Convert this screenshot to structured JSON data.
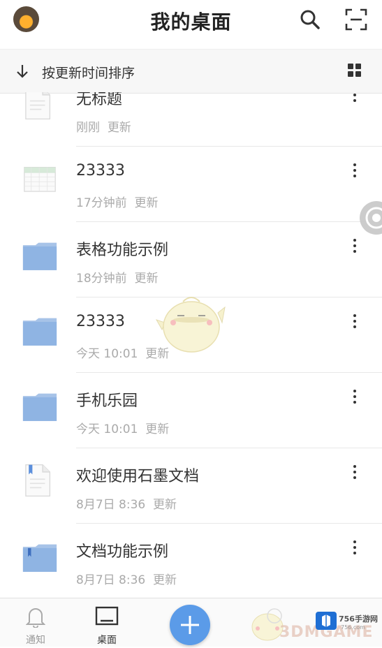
{
  "header": {
    "title": "我的桌面",
    "icons": [
      "avatar",
      "search-icon",
      "scan-icon"
    ]
  },
  "sortbar": {
    "label": "按更新时间排序",
    "icons": [
      "arrow-down-icon",
      "grid-view-icon"
    ]
  },
  "files": [
    {
      "name": "无标题",
      "time": "刚刚",
      "suffix": "更新",
      "type": "document"
    },
    {
      "name": "23333",
      "time": "17分钟前",
      "suffix": "更新",
      "type": "spreadsheet"
    },
    {
      "name": "表格功能示例",
      "time": "18分钟前",
      "suffix": "更新",
      "type": "folder"
    },
    {
      "name": "23333",
      "time": "今天 10:01",
      "suffix": "更新",
      "type": "folder"
    },
    {
      "name": "手机乐园",
      "time": "今天 10:01",
      "suffix": "更新",
      "type": "folder"
    },
    {
      "name": "欢迎使用石墨文档",
      "time": "8月7日 8:36",
      "suffix": "更新",
      "type": "document-bookmarked"
    },
    {
      "name": "文档功能示例",
      "time": "8月7日 8:36",
      "suffix": "更新",
      "type": "folder-bookmarked"
    }
  ],
  "bottom_nav": {
    "tabs": [
      {
        "label": "通知",
        "icon": "bell-icon",
        "active": false
      },
      {
        "label": "桌面",
        "icon": "desktop-icon",
        "active": true
      }
    ],
    "fab_icon": "plus-icon"
  },
  "watermark": {
    "text": "3DMGAME",
    "badge": "756手游网",
    "url": "756.com"
  },
  "colors": {
    "accent": "#5b9be8",
    "folder": "#8fb4e3",
    "text_primary": "#333333",
    "text_secondary": "#aaaaaa"
  }
}
